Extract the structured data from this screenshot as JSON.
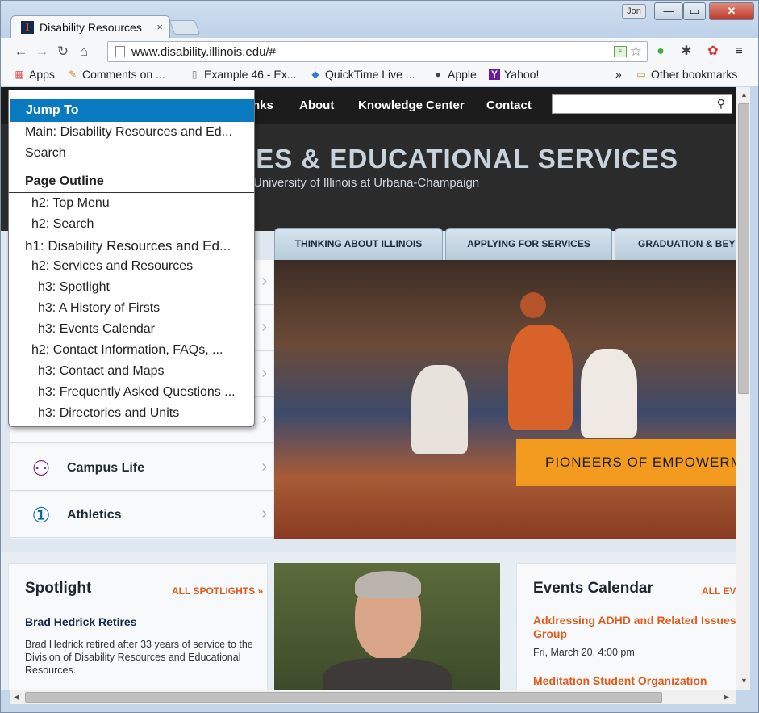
{
  "browser": {
    "tab_title": "Disability Resources",
    "tab_close": "×",
    "user_button": "Jon",
    "url": "www.disability.illinois.edu/#",
    "window_buttons": {
      "minimize": "—",
      "maximize": "▭",
      "close": "✕"
    }
  },
  "bookmarks": {
    "items": [
      {
        "label": "Apps",
        "icon": "apps-grid-icon"
      },
      {
        "label": "Comments on ...",
        "icon": "bookmark-page-icon"
      },
      {
        "label": "Example 46 - Ex...",
        "icon": "page-icon"
      },
      {
        "label": "QuickTime Live ...",
        "icon": "quicktime-icon"
      },
      {
        "label": "Apple",
        "icon": "apple-icon"
      },
      {
        "label": "Yahoo!",
        "icon": "yahoo-icon"
      }
    ],
    "overflow": "»",
    "other": "Other bookmarks"
  },
  "site": {
    "nav": [
      "nks",
      "About",
      "Knowledge Center",
      "Contact"
    ],
    "title": "RCES & EDUCATIONAL SERVICES",
    "subtitle": "University of Illinois at Urbana-Champaign",
    "hero_tabs": [
      "THINKING ABOUT ILLINOIS",
      "APPLYING FOR SERVICES",
      "GRADUATION & BEY"
    ],
    "banner": "PIONEERS OF EMPOWERM",
    "sidebar": [
      {
        "label": "Campus Life",
        "icon": "campus-life-icon"
      },
      {
        "label": "Athletics",
        "icon": "athletics-medal-icon"
      }
    ],
    "spotlight": {
      "heading": "Spotlight",
      "more": "ALL SPOTLIGHTS »",
      "headline": "Brad Hedrick Retires",
      "body": "Brad Hedrick retired after 33 years of service to the Division of Disability Resources and Educational Resources."
    },
    "events": {
      "heading": "Events Calendar",
      "more": "ALL EV",
      "items": [
        {
          "title": "Addressing ADHD and Related Issues Group",
          "date": "Fri, March 20, 4:00 pm"
        },
        {
          "title": "Meditation Student Organization",
          "date": ""
        }
      ]
    }
  },
  "jump": {
    "header": "Jump To",
    "main": "Main: Disability Resources and Ed...",
    "search": "Search",
    "outline_header": "Page Outline",
    "outline": [
      "h2: Top Menu",
      "h2: Search",
      "h1: Disability Resources and Ed...",
      "h2: Services and Resources",
      "h3: Spotlight",
      "h3: A History of Firsts",
      "h3: Events Calendar",
      "h2: Contact Information, FAQs, ...",
      "h3: Contact and Maps",
      "h3: Frequently Asked Questions ...",
      "h3: Directories and Units"
    ]
  }
}
